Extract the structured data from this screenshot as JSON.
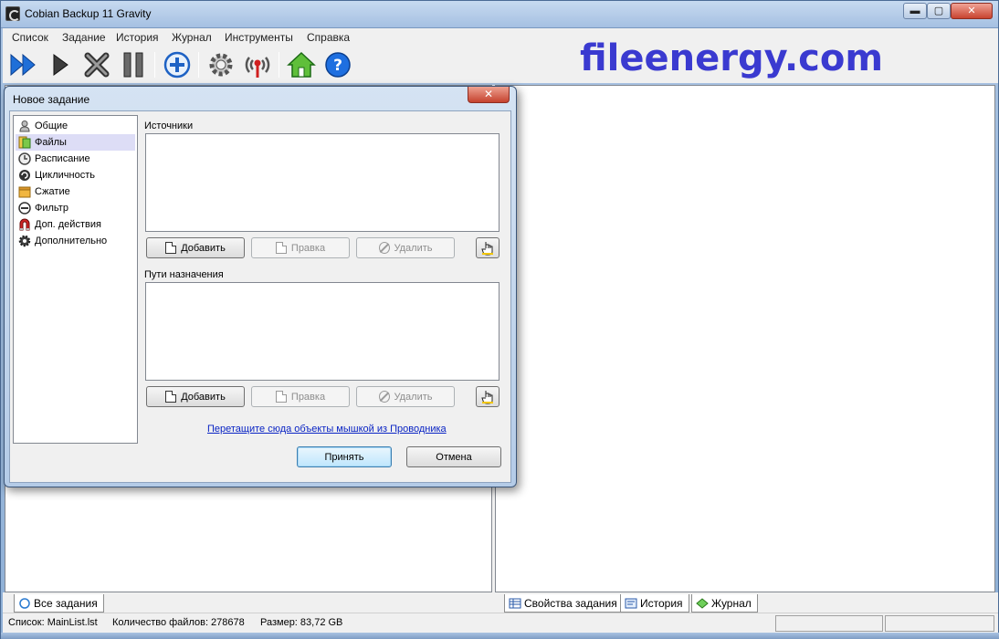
{
  "window": {
    "title": "Cobian Backup 11 Gravity",
    "min": "▬",
    "max": "▢",
    "close": "✕"
  },
  "menu": [
    "Список",
    "Задание",
    "История",
    "Журнал",
    "Инструменты",
    "Справка"
  ],
  "toolbar": {
    "icons": [
      "run-all-icon",
      "run-icon",
      "stop-icon",
      "pause-icon",
      "add-task-icon",
      "settings-icon",
      "remote-icon",
      "home-icon",
      "help-icon"
    ]
  },
  "watermark": "fileenergy.com",
  "left_tab": {
    "label": "Все задания"
  },
  "right_tabs": [
    {
      "label": "Свойства задания"
    },
    {
      "label": "История"
    },
    {
      "label": "Журнал"
    }
  ],
  "status": {
    "list": "Список: MainList.lst",
    "files": "Количество файлов: 278678",
    "size": "Размер: 83,72 GB"
  },
  "dialog": {
    "title": "Новое задание",
    "close": "✕",
    "nav": [
      {
        "label": "Общие",
        "icon": "person-icon"
      },
      {
        "label": "Файлы",
        "icon": "files-icon",
        "selected": true
      },
      {
        "label": "Расписание",
        "icon": "clock-icon"
      },
      {
        "label": "Цикличность",
        "icon": "cycle-icon"
      },
      {
        "label": "Сжатие",
        "icon": "archive-icon"
      },
      {
        "label": "Фильтр",
        "icon": "filter-icon"
      },
      {
        "label": "Доп. действия",
        "icon": "magnet-icon"
      },
      {
        "label": "Дополнительно",
        "icon": "gear-icon"
      }
    ],
    "sources": {
      "label": "Источники",
      "add": "Добавить",
      "edit": "Правка",
      "delete": "Удалить"
    },
    "destinations": {
      "label": "Пути назначения",
      "add": "Добавить",
      "edit": "Правка",
      "delete": "Удалить"
    },
    "drop_hint": "Перетащите сюда объекты мышкой из Проводника",
    "accept": "Принять",
    "cancel": "Отмена"
  },
  "colors": {
    "accent": "#3a3ad0",
    "selection": "#ddddf6",
    "link": "#0a24c4"
  }
}
